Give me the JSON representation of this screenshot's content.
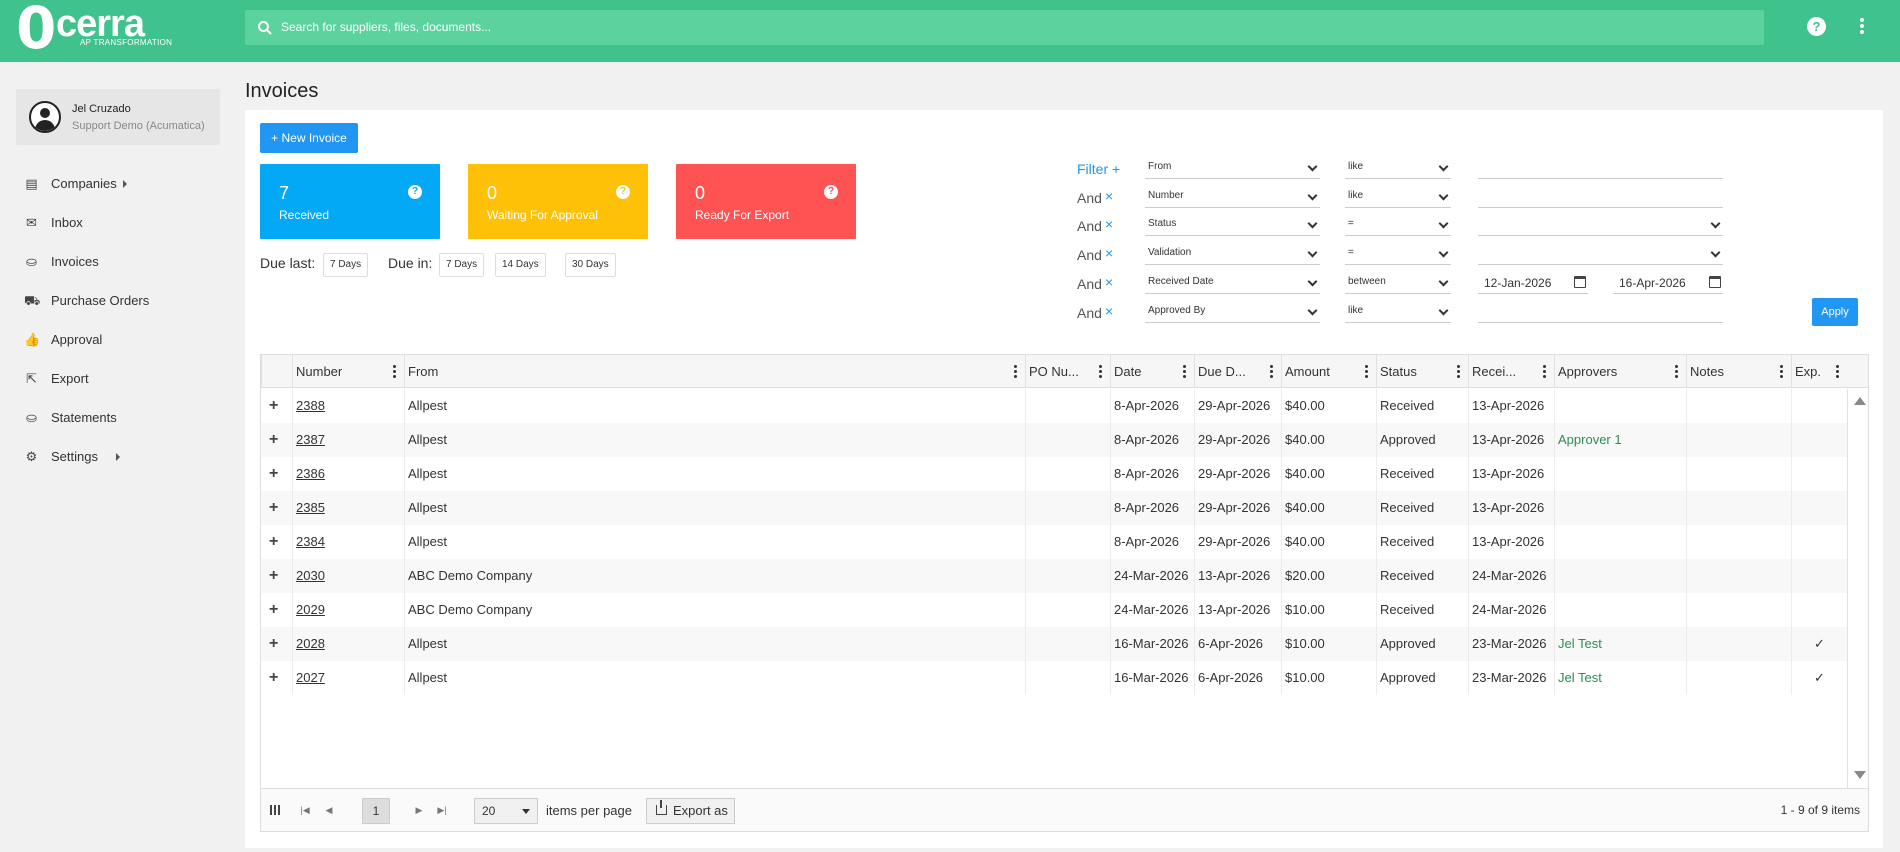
{
  "brand": {
    "logo_mark": "0",
    "logo_word": "cerra",
    "logo_tag": "AP TRANSFORMATION",
    "color": "#3fc28c"
  },
  "search": {
    "placeholder": "Search for suppliers, files, documents..."
  },
  "header": {
    "help_label": "?"
  },
  "user": {
    "name": "Jel Cruzado",
    "org": "Support Demo (Acumatica)"
  },
  "nav": [
    {
      "label": "Companies",
      "icon": "companies-icon",
      "caret": true
    },
    {
      "label": "Inbox",
      "icon": "inbox-icon",
      "caret": false
    },
    {
      "label": "Invoices",
      "icon": "basket-icon",
      "caret": false
    },
    {
      "label": "Purchase Orders",
      "icon": "cart-icon",
      "caret": false
    },
    {
      "label": "Approval",
      "icon": "thumbs-icon",
      "caret": false
    },
    {
      "label": "Export",
      "icon": "export-icon",
      "caret": false
    },
    {
      "label": "Statements",
      "icon": "basket-icon",
      "caret": false
    },
    {
      "label": "Settings",
      "icon": "gear-icon",
      "caret": true
    }
  ],
  "page": {
    "title": "Invoices",
    "new_button": "+ New Invoice"
  },
  "tiles": [
    {
      "count": "7",
      "label": "Received",
      "color": "#03a9f4"
    },
    {
      "count": "0",
      "label": "Waiting For Approval",
      "color": "#ffc107"
    },
    {
      "count": "0",
      "label": "Ready For Export",
      "color": "#ff5252"
    }
  ],
  "due": {
    "last_label": "Due last:",
    "last_chips": [
      "7 Days"
    ],
    "in_label": "Due in:",
    "in_chips": [
      "7 Days",
      "14 Days",
      "30 Days"
    ]
  },
  "filters": {
    "filter_label": "Filter +",
    "and_label": "And",
    "remove_symbol": "×",
    "rows": [
      {
        "field": "From",
        "op": "like",
        "value": ""
      },
      {
        "field": "Number",
        "op": "like",
        "value": ""
      },
      {
        "field": "Status",
        "op": "=",
        "value": "",
        "value_select": true
      },
      {
        "field": "Validation",
        "op": "=",
        "value": "",
        "value_select": true
      },
      {
        "field": "Received Date",
        "op": "between",
        "date_from": "12-Jan-2026",
        "date_to": "16-Apr-2026"
      },
      {
        "field": "Approved By",
        "op": "like",
        "value": ""
      }
    ],
    "apply_label": "Apply"
  },
  "grid": {
    "columns": [
      "Number",
      "From",
      "PO Nu...",
      "Date",
      "Due D...",
      "Amount",
      "Status",
      "Recei...",
      "Approvers",
      "Notes",
      "Exp."
    ],
    "rows": [
      {
        "number": "2388",
        "from": "Allpest",
        "po": "",
        "date": "8-Apr-2026",
        "due": "29-Apr-2026",
        "amount": "$40.00",
        "status": "Received",
        "received": "13-Apr-2026",
        "approvers": "",
        "notes": "",
        "exp": ""
      },
      {
        "number": "2387",
        "from": "Allpest",
        "po": "",
        "date": "8-Apr-2026",
        "due": "29-Apr-2026",
        "amount": "$40.00",
        "status": "Approved",
        "received": "13-Apr-2026",
        "approvers": "Approver 1",
        "notes": "",
        "exp": ""
      },
      {
        "number": "2386",
        "from": "Allpest",
        "po": "",
        "date": "8-Apr-2026",
        "due": "29-Apr-2026",
        "amount": "$40.00",
        "status": "Received",
        "received": "13-Apr-2026",
        "approvers": "",
        "notes": "",
        "exp": ""
      },
      {
        "number": "2385",
        "from": "Allpest",
        "po": "",
        "date": "8-Apr-2026",
        "due": "29-Apr-2026",
        "amount": "$40.00",
        "status": "Received",
        "received": "13-Apr-2026",
        "approvers": "",
        "notes": "",
        "exp": ""
      },
      {
        "number": "2384",
        "from": "Allpest",
        "po": "",
        "date": "8-Apr-2026",
        "due": "29-Apr-2026",
        "amount": "$40.00",
        "status": "Received",
        "received": "13-Apr-2026",
        "approvers": "",
        "notes": "",
        "exp": ""
      },
      {
        "number": "2030",
        "from": "ABC Demo Company",
        "po": "",
        "date": "24-Mar-2026",
        "due": "13-Apr-2026",
        "amount": "$20.00",
        "status": "Received",
        "received": "24-Mar-2026",
        "approvers": "",
        "notes": "",
        "exp": ""
      },
      {
        "number": "2029",
        "from": "ABC Demo Company",
        "po": "",
        "date": "24-Mar-2026",
        "due": "13-Apr-2026",
        "amount": "$10.00",
        "status": "Received",
        "received": "24-Mar-2026",
        "approvers": "",
        "notes": "",
        "exp": ""
      },
      {
        "number": "2028",
        "from": "Allpest",
        "po": "",
        "date": "16-Mar-2026",
        "due": "6-Apr-2026",
        "amount": "$10.00",
        "status": "Approved",
        "received": "23-Mar-2026",
        "approvers": "Jel Test",
        "notes": "",
        "exp": "✓"
      },
      {
        "number": "2027",
        "from": "Allpest",
        "po": "",
        "date": "16-Mar-2026",
        "due": "6-Apr-2026",
        "amount": "$10.00",
        "status": "Approved",
        "received": "23-Mar-2026",
        "approvers": "Jel Test",
        "notes": "",
        "exp": "✓"
      }
    ]
  },
  "pager": {
    "current_page": "1",
    "page_size": "20",
    "items_per_page_label": "items per page",
    "export_label": "Export as",
    "info": "1 - 9 of 9 items"
  }
}
